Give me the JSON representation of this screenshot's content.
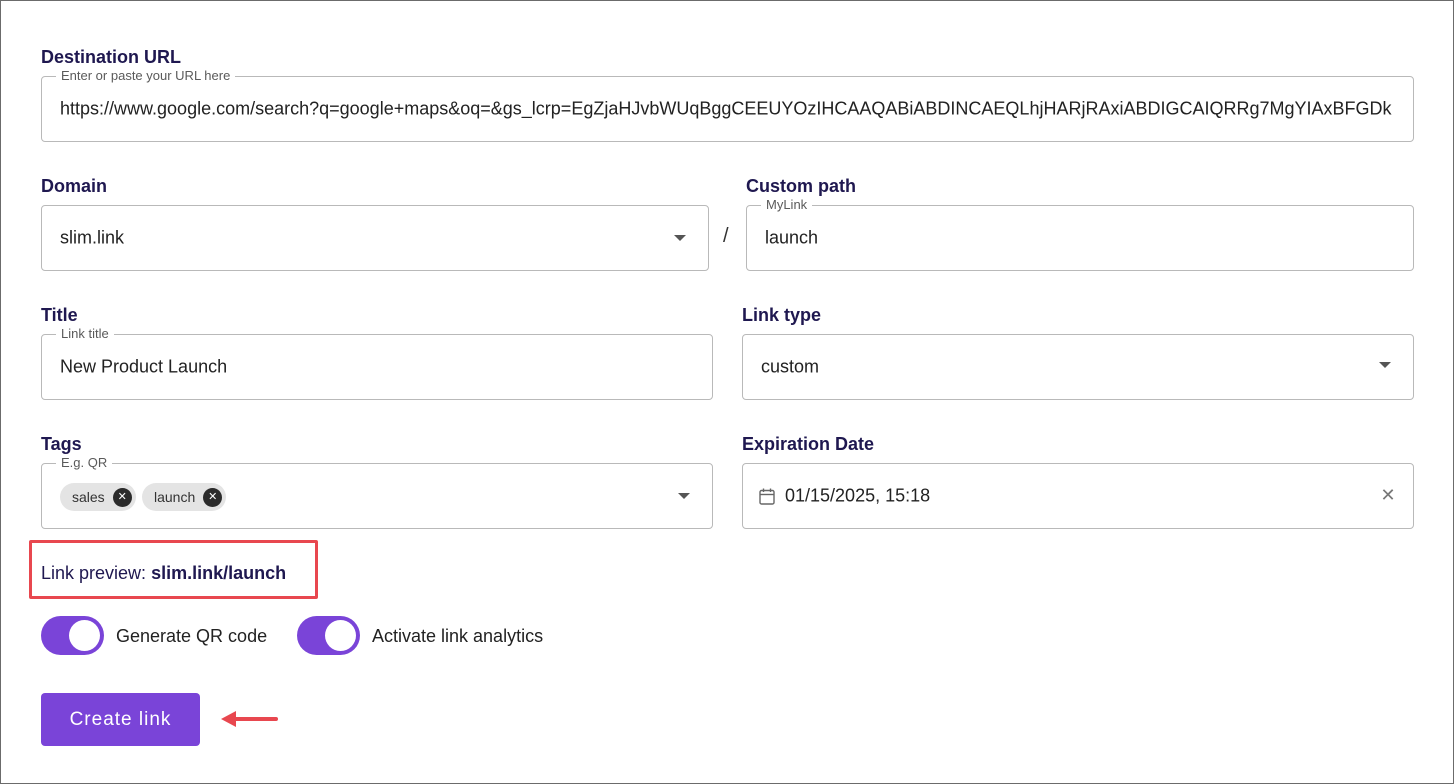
{
  "destination": {
    "label": "Destination URL",
    "legend": "Enter or paste your URL here",
    "value": "https://www.google.com/search?q=google+maps&oq=&gs_lcrp=EgZjaHJvbWUqBggCEEUYOzIHCAAQABiABDINCAEQLhjHARjRAxiABDIGCAIQRRg7MgYIAxBFGDk"
  },
  "domain": {
    "label": "Domain",
    "value": "slim.link",
    "icon": "chevron-down-icon"
  },
  "separator": "/",
  "custom_path": {
    "label": "Custom path",
    "legend": "MyLink",
    "value": "launch"
  },
  "title": {
    "label": "Title",
    "legend": "Link title",
    "value": "New Product Launch"
  },
  "link_type": {
    "label": "Link type",
    "value": "custom",
    "icon": "chevron-down-icon"
  },
  "tags": {
    "label": "Tags",
    "legend": "E.g. QR",
    "chips": [
      "sales",
      "launch"
    ],
    "remove_icon": "close-circle-icon"
  },
  "expiration": {
    "label": "Expiration Date",
    "value": "01/15/2025, 15:18",
    "icon": "calendar-icon",
    "clear_icon": "close-icon"
  },
  "preview": {
    "prefix": "Link preview:",
    "url": "slim.link/launch"
  },
  "toggles": {
    "qr": {
      "label": "Generate QR code",
      "on": true
    },
    "analytics": {
      "label": "Activate link analytics",
      "on": true
    }
  },
  "create_button": "Create link",
  "colors": {
    "accent": "#7a44d8",
    "label": "#1f1850",
    "highlight": "#e8474f"
  }
}
